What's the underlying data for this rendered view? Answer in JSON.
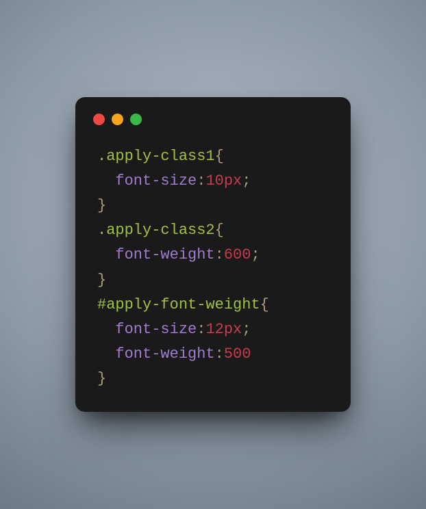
{
  "traffic_lights": {
    "red": "#ec4947",
    "yellow": "#f6a41c",
    "green": "#3ab748"
  },
  "code": {
    "rule1": {
      "selector": ".apply-class1",
      "open": "{",
      "prop1": "font-size",
      "colon": ":",
      "val1": "10px",
      "semi": ";",
      "close": "}"
    },
    "rule2": {
      "selector": ".apply-class2",
      "open": "{",
      "prop1": "font-weight",
      "colon": ":",
      "val1": "600",
      "semi": ";",
      "close": "}"
    },
    "rule3": {
      "selector": "#apply-font-weight",
      "open": "{",
      "prop1": "font-size",
      "colon1": ":",
      "val1": "12px",
      "semi1": ";",
      "prop2": "font-weight",
      "colon2": ":",
      "val2": "500",
      "close": "}"
    }
  }
}
